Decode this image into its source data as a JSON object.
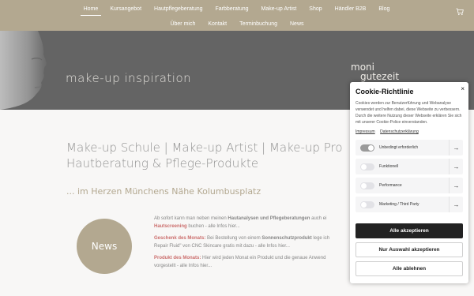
{
  "nav": {
    "row1": [
      "Home",
      "Kursangebot",
      "Hautpflegeberatung",
      "Farbberatung",
      "Make-up Artist",
      "Shop",
      "Händler B2B",
      "Blog"
    ],
    "row2": [
      "Über mich",
      "Kontakt",
      "Terminbuchung",
      "News"
    ],
    "active": "Home",
    "cart_icon": "cart-icon"
  },
  "hero": {
    "title": "make-up inspiration",
    "logo_line1": "moni",
    "logo_line2": "gutezeit"
  },
  "main": {
    "headline_line1": "Make-up Schule | Make-up Artist | Make-up Pro",
    "headline_line2": "Hautberatung & Pflege-Produkte",
    "subline": "... im Herzen Münchens Nähe Kolumbusplatz",
    "news_label": "News",
    "p1_a": "Ab sofort kann man neben meinen ",
    "p1_b": "Hautanalysen und Pflegeberatungen",
    "p1_c": " auch ei",
    "p1_d": "Hautscreening",
    "p1_e": " buchen -  alle Infos hier...",
    "p2_a": "Geschenk des Monats:",
    "p2_b": " Bei Bestellung von einem ",
    "p2_c": "Sonnenschutzprodukt",
    "p2_d": " lege ich",
    "p2_e": "Repair Fluid\" von CNC Skincare gratis mit dazu - alle Infos hier...",
    "p3_a": "Produkt des Monats:",
    "p3_b": " Hier wird jeden Monat ein Produkt und die genaue Anwend",
    "p3_c": "vorgestellt - alle Infos hier..."
  },
  "cookie": {
    "title": "Cookie-Richtlinie",
    "close": "×",
    "description": "Cookies werden zur Benutzerführung und Webanalyse verwendet und helfen dabei, diese Webseite zu verbessern. Durch die weitere Nutzung dieser Webseite erklären Sie sich mit unserer Cookie-Police einverstanden.",
    "link_impressum": "Impressum",
    "link_datenschutz": "Datenschutzerklärung",
    "categories": [
      {
        "label": "Unbedingt erforderlich",
        "on": true
      },
      {
        "label": "Funktionell",
        "on": false
      },
      {
        "label": "Performance",
        "on": false
      },
      {
        "label": "Marketing / Third Party",
        "on": false
      }
    ],
    "arrow": "→",
    "btn_accept_all": "Alle akzeptieren",
    "btn_accept_selection": "Nur Auswahl akzeptieren",
    "btn_reject_all": "Alle ablehnen"
  },
  "colors": {
    "brand_gold": "#8a7a55",
    "hero_bg": "#121212",
    "accent_red": "#b0201e",
    "button_dark": "#222222"
  }
}
